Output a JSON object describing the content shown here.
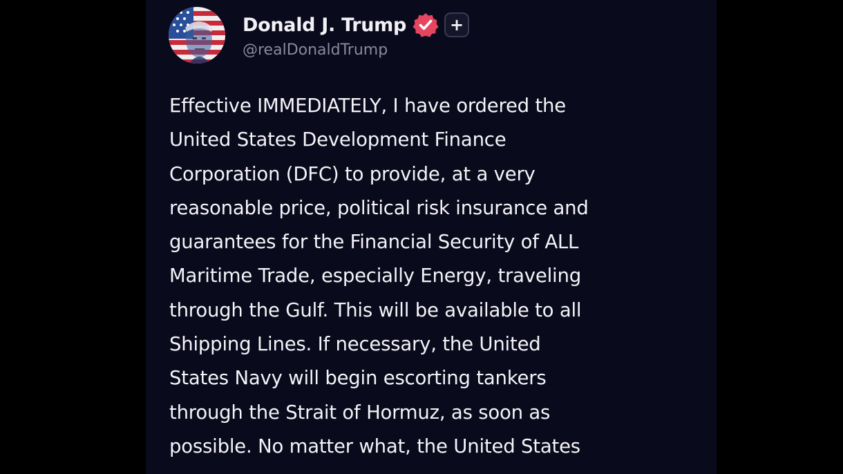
{
  "colors": {
    "background": "#000000",
    "panel": "#0a0a1d",
    "text": "#f4f4f8",
    "handle": "#8a8a9c",
    "verified_badge": "#e5455e"
  },
  "post": {
    "author": {
      "display_name": "Donald J. Trump",
      "handle": "@realDonaldTrump",
      "avatar_icon": "avatar-flag-portrait",
      "verified_icon": "verified-badge-icon",
      "follow_icon": "plus-icon",
      "follow_symbol": "+"
    },
    "lines": [
      "Effective IMMEDIATELY, I have ordered the",
      "United States Development Finance",
      "Corporation (DFC) to provide, at a very",
      "reasonable price, political risk insurance and",
      "guarantees for the Financial Security of ALL",
      "Maritime Trade, especially Energy, traveling",
      "through the Gulf. This will be available to all",
      "Shipping Lines. If necessary, the United",
      "States Navy will begin escorting tankers",
      "through the Strait of Hormuz, as soon as",
      "possible. No matter what, the United States"
    ]
  }
}
